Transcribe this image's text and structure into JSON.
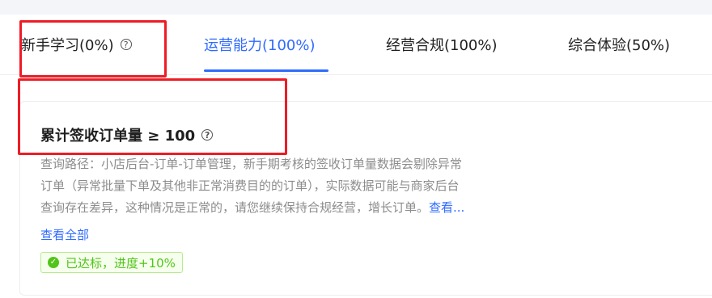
{
  "tabs": [
    {
      "label": "新手学习(0%)",
      "active": false,
      "has_help": true
    },
    {
      "label": "运营能力(100%)",
      "active": true,
      "has_help": false
    },
    {
      "label": "经营合规(100%)",
      "active": false,
      "has_help": false
    },
    {
      "label": "综合体验(50%)",
      "active": false,
      "has_help": false
    }
  ],
  "card": {
    "title": "累计签收订单量 ≥ 100",
    "description": {
      "line1": "查询路径：小店后台-订单-订单管理，新手期考核的签收订单量数据会剔除异常",
      "line2": "订单（异常批量下单及其他非正常消费目的的订单），实际数据可能与商家后台",
      "line3": "查询存在差异，这种情况是正常的，请您继续保持合规经营，增长订单。",
      "more_link": "查看..."
    },
    "view_all": "查看全部",
    "status_badge": "已达标，进度+10%"
  },
  "icons": {
    "help": "question-circle-icon",
    "check": "check-circle-icon"
  },
  "colors": {
    "accent": "#2f6bff",
    "highlight_box": "#ee1c25",
    "success": "#52c41a",
    "success_bg": "#f6ffed",
    "muted_text": "#8c8c8c"
  }
}
